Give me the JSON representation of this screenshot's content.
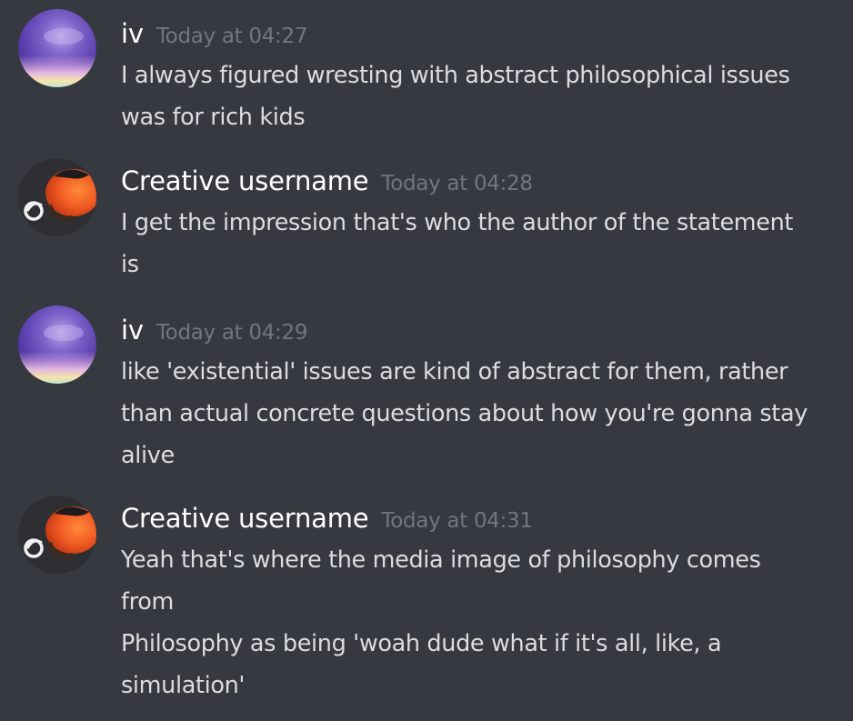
{
  "colors": {
    "background": "#36393f",
    "username": "#ffffff",
    "timestamp": "#72767d",
    "text": "#dcddde"
  },
  "messages": [
    {
      "username": "iv",
      "timestamp": "Today at 04:27",
      "avatar_icon": "purple-sky-avatar-icon",
      "lines": [
        "I always figured wresting with abstract philosophical issues",
        "was for rich kids"
      ]
    },
    {
      "username": "Creative username",
      "timestamp": "Today at 04:28",
      "avatar_icon": "orange-bird-avatar-icon",
      "lines": [
        "I get the impression that's who the author of the statement",
        "is"
      ]
    },
    {
      "username": "iv",
      "timestamp": "Today at 04:29",
      "avatar_icon": "purple-sky-avatar-icon",
      "lines": [
        "like 'existential' issues are kind of abstract for them, rather",
        "than actual concrete questions about how you're gonna stay",
        "alive"
      ]
    },
    {
      "username": "Creative username",
      "timestamp": "Today at 04:31",
      "avatar_icon": "orange-bird-avatar-icon",
      "lines": [
        "Yeah that's where the media image of philosophy comes",
        "from",
        "Philosophy as being 'woah dude what if it's all, like, a",
        "simulation'"
      ]
    }
  ]
}
